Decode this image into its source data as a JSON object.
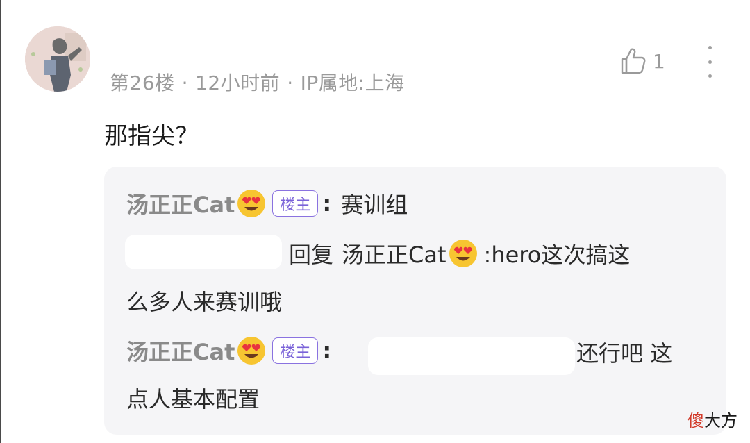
{
  "post": {
    "floor": "第26楼",
    "separator": "·",
    "time": "12小时前",
    "ip": "IP属地:上海",
    "likes": "1",
    "comment": "那指尖？"
  },
  "replies": {
    "r1": {
      "name": "汤正正Cat",
      "badge": "楼主",
      "colon": ":",
      "text": "赛训组"
    },
    "r2": {
      "reply_word": "回复",
      "target": "汤正正Cat",
      "text_a": ":hero这次搞这",
      "text_b": "么多人来赛训哦"
    },
    "r3": {
      "name": "汤正正Cat",
      "badge": "楼主",
      "colon": ":",
      "text_a": "还行吧 这",
      "text_b": "点人基本配置"
    }
  },
  "watermark": {
    "part1": "傻",
    "part2": "大方"
  },
  "icons": {
    "like": "thumbs-up-icon",
    "more": "more-vertical-icon",
    "emoji": "heart-eyes-emoji-icon"
  },
  "colors": {
    "badge": "#7a62d8",
    "reply_bg": "#f5f5f7",
    "meta": "#9a9a9a"
  }
}
